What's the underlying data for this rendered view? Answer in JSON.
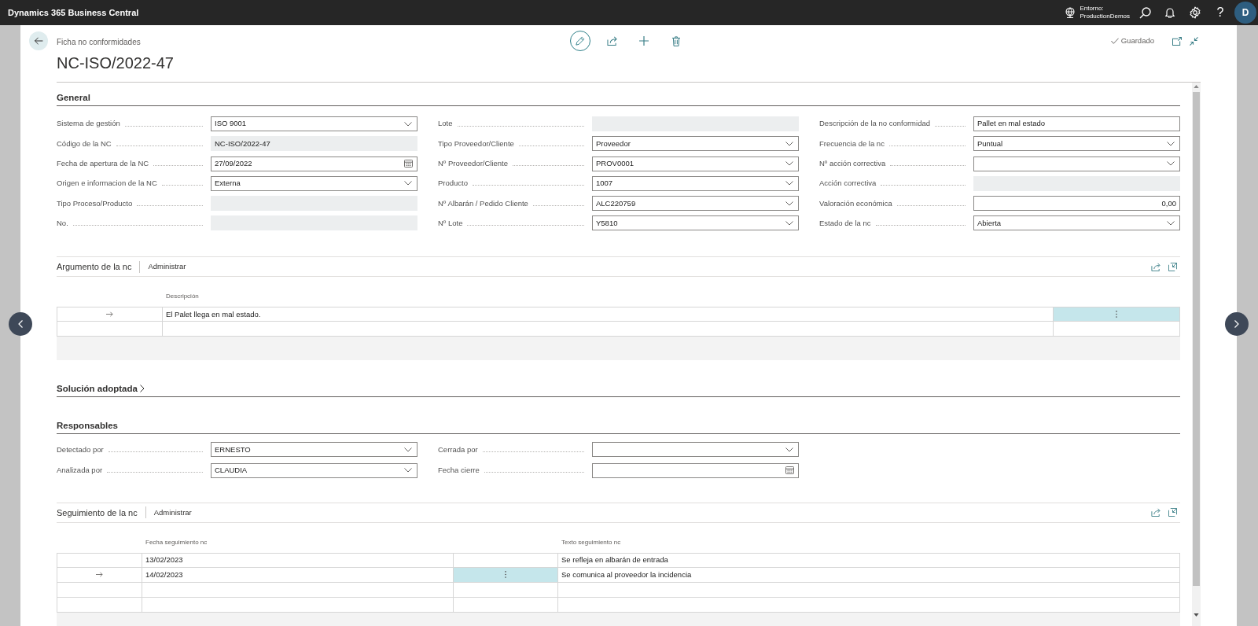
{
  "app_bar": {
    "title": "Dynamics 365 Business Central",
    "environment_label": "Entorno:",
    "environment_name": "ProductionDemos",
    "help": "?",
    "avatar_initial": "D"
  },
  "page": {
    "breadcrumb": "Ficha no conformidades",
    "title": "NC-ISO/2022-47",
    "save_status": "Guardado"
  },
  "sections": [
    {
      "kind": "fields",
      "title": "General",
      "columns": [
        [
          {
            "label": "Sistema de gestión",
            "kind": "dropdown",
            "value": "ISO 9001"
          },
          {
            "label": "Código de la NC",
            "kind": "readonly",
            "value": "NC-ISO/2022-47"
          },
          {
            "label": "Fecha de apertura de la NC",
            "kind": "date",
            "value": "27/09/2022"
          },
          {
            "label": "Origen e informacion de la NC",
            "kind": "dropdown",
            "value": "Externa"
          },
          {
            "label": "Tipo Proceso/Producto",
            "kind": "readonly"
          },
          {
            "label": "No.",
            "kind": "readonly"
          }
        ],
        [
          {
            "label": "Lote",
            "kind": "readonly"
          },
          {
            "label": "Tipo Proveedor/Cliente",
            "kind": "dropdown",
            "value": "Proveedor"
          },
          {
            "label": "Nº Proveedor/Cliente",
            "kind": "dropdown",
            "value": "PROV0001"
          },
          {
            "label": "Producto",
            "kind": "dropdown",
            "value": "1007"
          },
          {
            "label": "Nº Albarán / Pedido Cliente",
            "kind": "dropdown",
            "value": "ALC220759"
          },
          {
            "label": "Nº Lote",
            "kind": "dropdown",
            "value": "Y5810"
          }
        ],
        [
          {
            "label": "Descripción de la no conformidad",
            "kind": "text",
            "value": "Pallet en mal estado"
          },
          {
            "label": "Frecuencia de la nc",
            "kind": "dropdown",
            "value": "Puntual"
          },
          {
            "label": "Nº acción correctiva",
            "kind": "dropdown"
          },
          {
            "label": "Acción correctiva",
            "kind": "readonly"
          },
          {
            "label": "Valoración económica",
            "kind": "number",
            "value": "0,00"
          },
          {
            "label": "Estado de la nc",
            "kind": "dropdown",
            "value": "Abierta"
          }
        ]
      ]
    },
    {
      "kind": "part",
      "title": "Argumento de la nc",
      "action": "Administrar",
      "columns": [
        {
          "kind": "marker"
        },
        {
          "kind": "data",
          "header": "Descripción"
        },
        {
          "kind": "menu"
        }
      ],
      "rows": [
        {
          "selected": true,
          "cells": [
            "El Palet llega en mal estado."
          ]
        },
        {
          "selected": false
        }
      ]
    },
    {
      "kind": "collapsed",
      "title": "Solución adoptada",
      "expanded": false
    },
    {
      "kind": "fields",
      "title": "Responsables",
      "columns": [
        [
          {
            "label": "Detectado por",
            "kind": "dropdown",
            "value": "ERNESTO"
          },
          {
            "label": "Analizada por",
            "kind": "dropdown",
            "value": "CLAUDIA"
          }
        ],
        [
          {
            "label": "Cerrada por",
            "kind": "dropdown"
          },
          {
            "label": "Fecha cierre",
            "kind": "date"
          }
        ]
      ]
    },
    {
      "kind": "part",
      "title": "Seguimiento de la nc",
      "action": "Administrar",
      "columns": [
        {
          "kind": "marker"
        },
        {
          "kind": "data",
          "header": "Fecha seguimiento nc"
        },
        {
          "kind": "menu"
        },
        {
          "kind": "data",
          "header": "Texto seguimiento nc"
        }
      ],
      "rows": [
        {
          "selected": false,
          "cells": [
            "13/02/2023",
            "Se refleja en albarán de entrada"
          ]
        },
        {
          "selected": true,
          "cells": [
            "14/02/2023",
            "Se comunica al proveedor la incidencia"
          ]
        },
        {
          "selected": false
        },
        {
          "selected": false
        }
      ]
    }
  ]
}
